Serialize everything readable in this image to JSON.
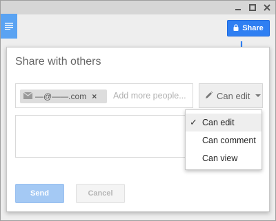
{
  "window": {
    "controls": [
      {
        "icon": "minimize-icon"
      },
      {
        "icon": "maximize-icon"
      },
      {
        "icon": "close-icon"
      }
    ]
  },
  "toolbar": {
    "menu_icon": "hamburger-menu-icon",
    "share_label": "Share",
    "share_icon": "lock-icon",
    "share_color": "#2f7ff2"
  },
  "dialog": {
    "title": "Share with others",
    "recipient": {
      "text": "—@——.com",
      "icon": "envelope-icon",
      "remove_label": "×"
    },
    "add_more_placeholder": "Add more people...",
    "permission": {
      "selected": "Can edit",
      "icon": "pencil-icon"
    },
    "dropdown": {
      "check_mark": "✓",
      "options": [
        {
          "label": "Can edit",
          "selected": true
        },
        {
          "label": "Can comment",
          "selected": false
        },
        {
          "label": "Can view",
          "selected": false
        }
      ]
    },
    "send_label": "Send",
    "cancel_label": "Cancel"
  }
}
